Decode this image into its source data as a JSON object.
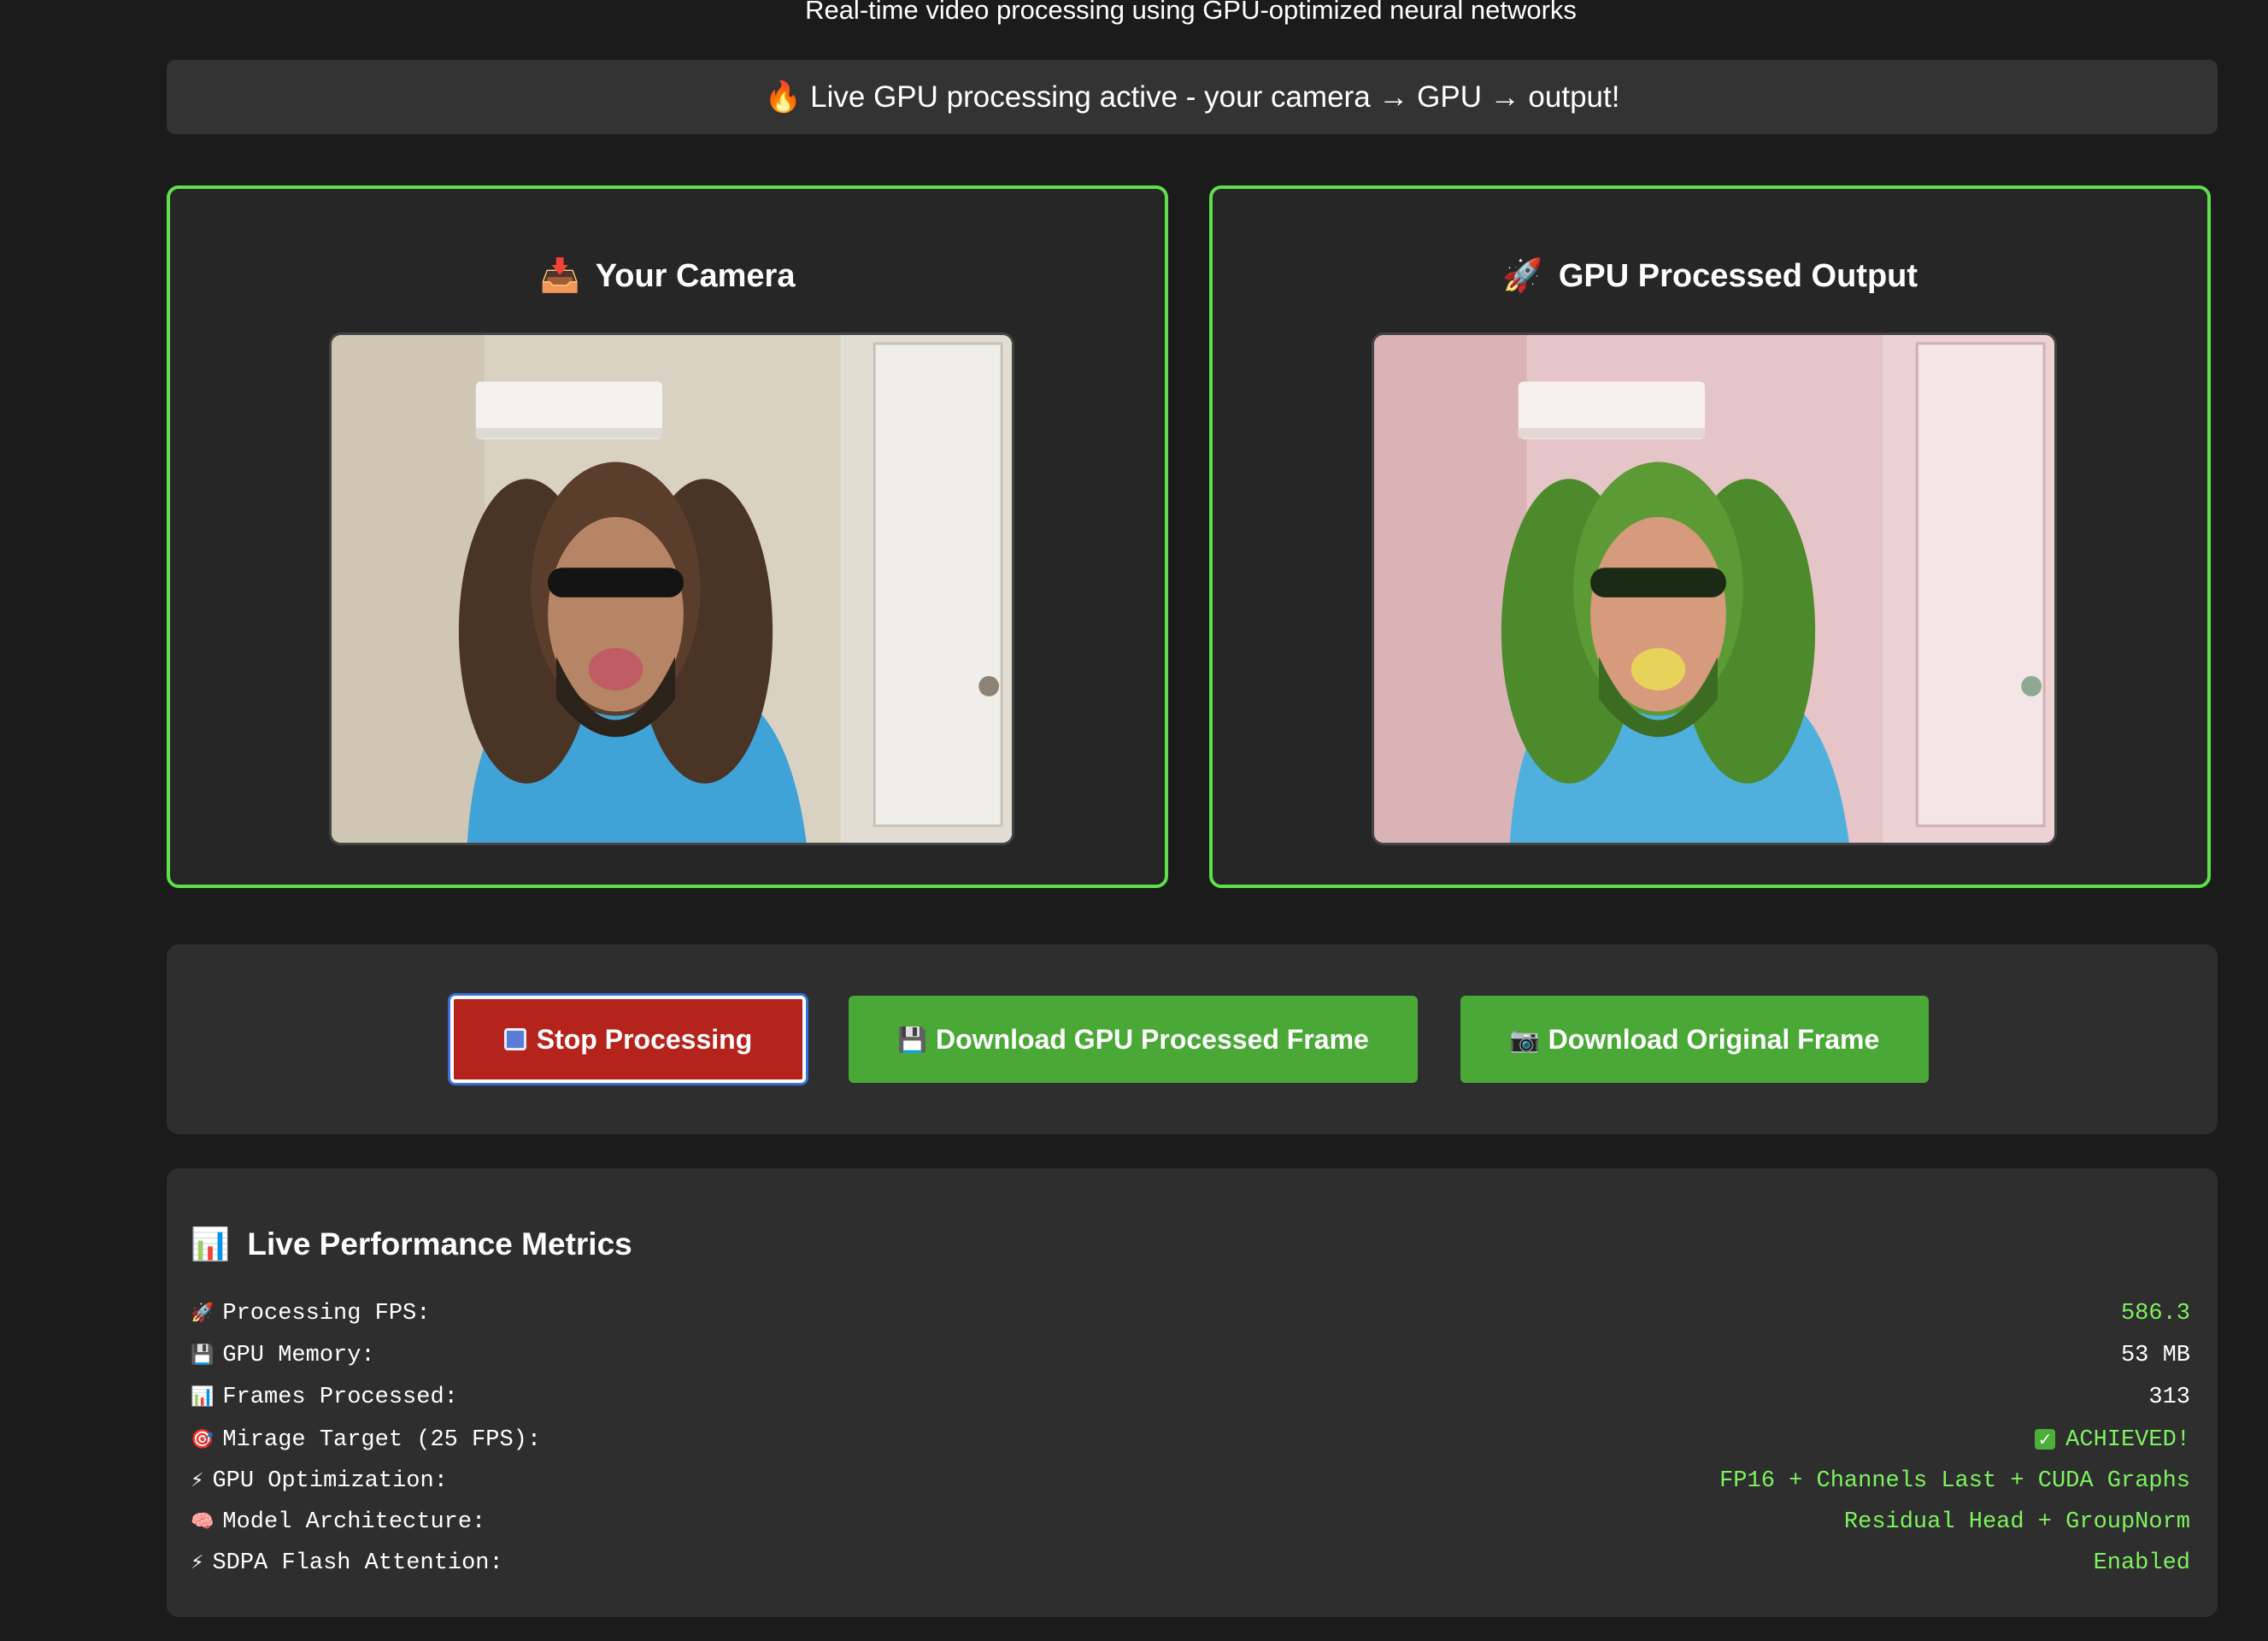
{
  "header": {
    "subtitle": "Real-time video processing using GPU-optimized neural networks"
  },
  "status": {
    "icon": "fire-icon",
    "text": "Live GPU processing active - your camera → GPU → output!"
  },
  "panels": {
    "camera": {
      "icon": "inbox-tray-icon",
      "title": "Your Camera"
    },
    "output": {
      "icon": "rocket-icon",
      "title": "GPU Processed Output"
    }
  },
  "controls": {
    "stop_label": "Stop Processing",
    "stop_icon": "stop-icon",
    "download_gpu_label": "Download GPU Processed Frame",
    "download_gpu_icon": "floppy-disk-icon",
    "download_original_label": "Download Original Frame",
    "download_original_icon": "camera-icon"
  },
  "metrics": {
    "title": "Live Performance Metrics",
    "title_icon": "bar-chart-icon",
    "rows": [
      {
        "icon": "rocket-icon",
        "label": "Processing FPS:",
        "value": "586.3",
        "color": "green"
      },
      {
        "icon": "floppy-disk-icon",
        "label": "GPU Memory:",
        "value": "53 MB",
        "color": "white"
      },
      {
        "icon": "bar-chart-icon",
        "label": "Frames Processed:",
        "value": "313",
        "color": "white"
      },
      {
        "icon": "target-icon",
        "label": "Mirage Target (25 FPS):",
        "value": "ACHIEVED!",
        "color": "green"
      },
      {
        "icon": "lightning-icon",
        "label": "GPU Optimization:",
        "value": "FP16 + Channels Last + CUDA Graphs",
        "color": "green"
      },
      {
        "icon": "brain-icon",
        "label": "Model Architecture:",
        "value": "Residual Head + GroupNorm",
        "color": "green"
      },
      {
        "icon": "lightning-icon",
        "label": "SDPA Flash Attention:",
        "value": "Enabled",
        "color": "green"
      }
    ]
  },
  "colors": {
    "accent_green": "#5ee04b",
    "value_green": "#7ef25f",
    "stop_red": "#b5241c",
    "button_green": "#49a836"
  }
}
